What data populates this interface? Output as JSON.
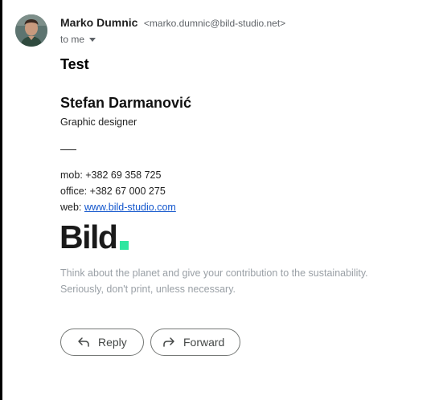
{
  "message": {
    "sender_name": "Marko Dumnic",
    "sender_email": "<marko.dumnic@bild-studio.net>",
    "recipient_label": "to me",
    "body_first_line": "Test"
  },
  "signature": {
    "name": "Stefan Darmanović",
    "role": "Graphic designer",
    "mobile": "mob: +382 69 358 725",
    "office": "office: +382 67 000 275",
    "web_prefix": "web: ",
    "web_link": "www.bild-studio.com",
    "logo_text": "Bild",
    "logo_accent_color": "#2ee6a0",
    "note_line_1": "Think about the planet and give your contribution to the sustainability.",
    "note_line_2": "Seriously, don't print, unless necessary."
  },
  "actions": {
    "reply_label": "Reply",
    "forward_label": "Forward"
  }
}
